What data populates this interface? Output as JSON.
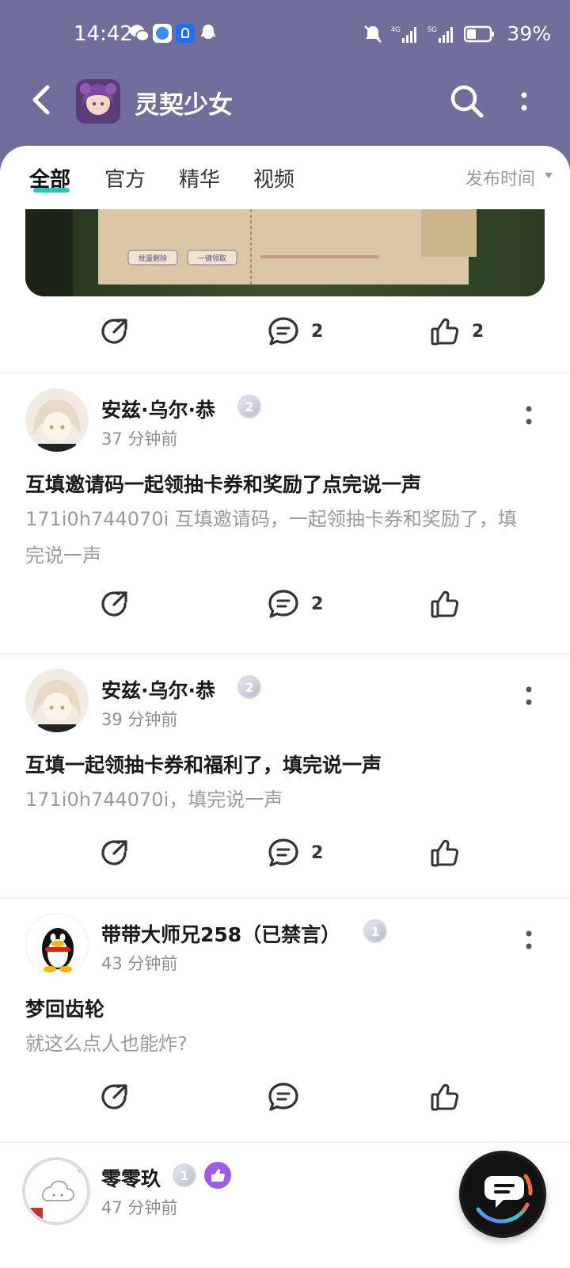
{
  "status_bar": {
    "time": "14:42",
    "network_1": "4G",
    "network_2": "5G",
    "battery": "39%"
  },
  "header": {
    "title": "灵契少女",
    "back_icon": "back-arrow-icon",
    "search_icon": "search-icon",
    "more_icon": "more-vertical-icon"
  },
  "tabs": [
    {
      "label": "全部",
      "active": true
    },
    {
      "label": "官方",
      "active": false
    },
    {
      "label": "精华",
      "active": false
    },
    {
      "label": "视频",
      "active": false
    }
  ],
  "sort_label": "发布时间",
  "image_buttons": {
    "batch_delete": "批量删除",
    "claim_all": "一键领取"
  },
  "first_post_actions": {
    "comments": "2",
    "likes": "2"
  },
  "posts": [
    {
      "author": "安兹·乌尔·恭",
      "level": "2",
      "time": "37 分钟前",
      "title": "互填邀请码一起领抽卡券和奖励了点完说一声",
      "body": "171i0h744070i 互填邀请码，一起领抽卡券和奖励了，填完说一声",
      "comments": "2",
      "likes": ""
    },
    {
      "author": "安兹·乌尔·恭",
      "level": "2",
      "time": "39 分钟前",
      "title": "互填一起领抽卡券和福利了，填完说一声",
      "body": "171i0h744070i，填完说一声",
      "comments": "2",
      "likes": ""
    },
    {
      "author": "带带大师兄258（已禁言）",
      "level": "1",
      "time": "43 分钟前",
      "title": "梦回齿轮",
      "body": "就这么点人也能炸?",
      "comments": "",
      "likes": ""
    },
    {
      "author": "零零玖",
      "level": "1",
      "time": "47 分钟前"
    }
  ],
  "colors": {
    "header_bg": "#726e9c",
    "tab_accent": "#2ec4b6",
    "muted_text": "#9a9a9a"
  }
}
